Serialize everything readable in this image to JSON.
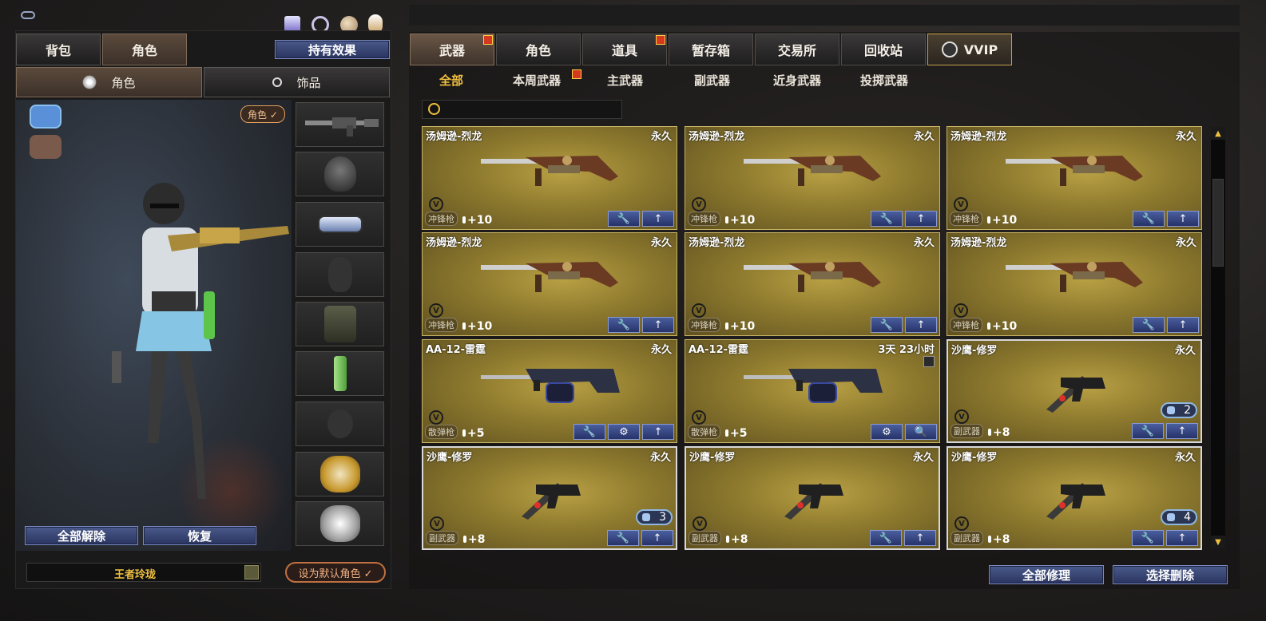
{
  "topbar": {
    "icon_left": "key-icon"
  },
  "left": {
    "tabs": [
      {
        "label": "背包"
      },
      {
        "label": "角色"
      }
    ],
    "effects_button": "持有效果",
    "subtabs": [
      {
        "label": "角色"
      },
      {
        "label": "饰品"
      }
    ],
    "role_badge": "角色 ✓",
    "reset_all": "全部解除",
    "restore": "恢复",
    "character_name": "王者玲珑",
    "set_default": "设为默认角色 ✓",
    "slots": [
      "rifle",
      "helmet",
      "goggles",
      "empty-character",
      "backpack",
      "grenade-bamboo",
      "grenade-empty",
      "wolf-gold",
      "wolf-silver"
    ]
  },
  "right": {
    "tabs": [
      {
        "label": "武器"
      },
      {
        "label": "角色"
      },
      {
        "label": "道具"
      },
      {
        "label": "暂存箱"
      },
      {
        "label": "交易所"
      },
      {
        "label": "回收站"
      },
      {
        "label": "VVIP"
      }
    ],
    "subtabs": [
      {
        "label": "全部"
      },
      {
        "label": "本周武器"
      },
      {
        "label": "主武器"
      },
      {
        "label": "副武器"
      },
      {
        "label": "近身武器"
      },
      {
        "label": "投掷武器"
      }
    ],
    "search_placeholder": "",
    "repair_all": "全部修理",
    "select_delete": "选择删除"
  },
  "items": [
    {
      "name": "汤姆逊-烈龙",
      "duration": "永久",
      "type": "冲锋枪",
      "level": "+10",
      "weapon": "tommy"
    },
    {
      "name": "汤姆逊-烈龙",
      "duration": "永久",
      "type": "冲锋枪",
      "level": "+10",
      "weapon": "tommy"
    },
    {
      "name": "汤姆逊-烈龙",
      "duration": "永久",
      "type": "冲锋枪",
      "level": "+10",
      "weapon": "tommy"
    },
    {
      "name": "汤姆逊-烈龙",
      "duration": "永久",
      "type": "冲锋枪",
      "level": "+10",
      "weapon": "tommy"
    },
    {
      "name": "汤姆逊-烈龙",
      "duration": "永久",
      "type": "冲锋枪",
      "level": "+10",
      "weapon": "tommy"
    },
    {
      "name": "汤姆逊-烈龙",
      "duration": "永久",
      "type": "冲锋枪",
      "level": "+10",
      "weapon": "tommy"
    },
    {
      "name": "AA-12-雷霆",
      "duration": "永久",
      "type": "散弹枪",
      "level": "+5",
      "weapon": "aa12"
    },
    {
      "name": "AA-12-雷霆",
      "duration": "3天 23小时",
      "type": "散弹枪",
      "level": "+5",
      "weapon": "aa12"
    },
    {
      "name": "沙鹰-修罗",
      "duration": "永久",
      "type": "副武器",
      "level": "+8",
      "weapon": "deagle",
      "count": "2"
    },
    {
      "name": "沙鹰-修罗",
      "duration": "永久",
      "type": "副武器",
      "level": "+8",
      "weapon": "deagle",
      "count": "3"
    },
    {
      "name": "沙鹰-修罗",
      "duration": "永久",
      "type": "副武器",
      "level": "+8",
      "weapon": "deagle"
    },
    {
      "name": "沙鹰-修罗",
      "duration": "永久",
      "type": "副武器",
      "level": "+8",
      "weapon": "deagle",
      "count": "4"
    }
  ]
}
